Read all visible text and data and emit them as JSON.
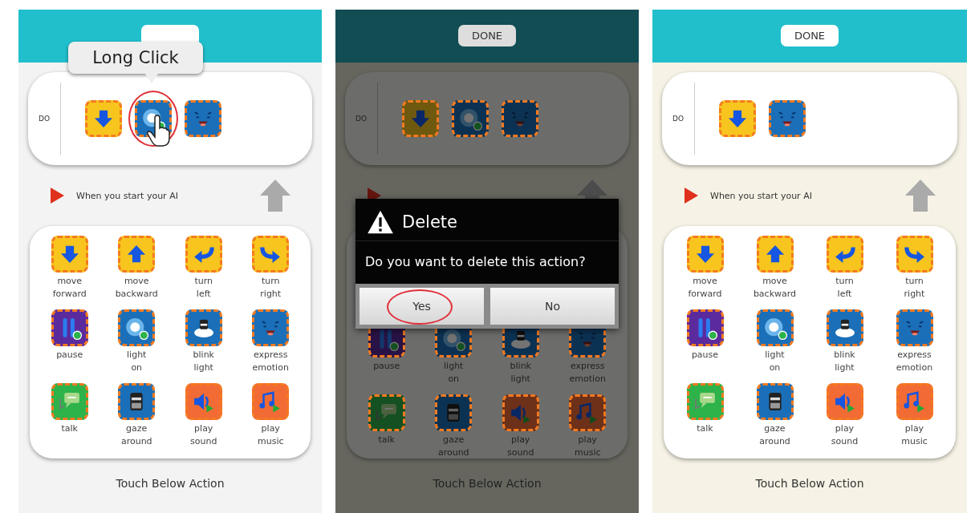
{
  "screens": [
    {
      "kind": "light",
      "tooltip": {
        "text": "Long Click"
      },
      "do_label": "DO",
      "do_items": [
        {
          "kind": "down",
          "color": "#f7c51e",
          "highlighted": false
        },
        {
          "kind": "light",
          "color": "#1a6fb8",
          "highlighted": true
        },
        {
          "kind": "emotion",
          "color": "#1a6fb8",
          "highlighted": false
        }
      ],
      "start_label": "When you start your AI",
      "palette": [
        {
          "kind": "down",
          "color": "#f7c51e",
          "label": "move\nforward"
        },
        {
          "kind": "up",
          "color": "#f7c51e",
          "label": "move\nbackward"
        },
        {
          "kind": "left",
          "color": "#f7c51e",
          "label": "turn\nleft"
        },
        {
          "kind": "right",
          "color": "#f7c51e",
          "label": "turn\nright"
        },
        {
          "kind": "pause",
          "color": "#5b2a9c",
          "label": "pause"
        },
        {
          "kind": "light",
          "color": "#1a6fb8",
          "label": "light\non"
        },
        {
          "kind": "blink",
          "color": "#1a6fb8",
          "label": "blink\nlight"
        },
        {
          "kind": "emotion",
          "color": "#1a6fb8",
          "label": "express\nemotion"
        },
        {
          "kind": "talk",
          "color": "#2db34a",
          "label": "talk"
        },
        {
          "kind": "gaze",
          "color": "#1a6fb8",
          "label": "gaze\naround"
        },
        {
          "kind": "sound",
          "color": "#f26b35",
          "label": "play\nsound"
        },
        {
          "kind": "music",
          "color": "#f26b35",
          "label": "play\nmusic"
        }
      ],
      "footer": "Touch Below Action"
    },
    {
      "kind": "dimmed",
      "done_label": "DONE",
      "do_label": "DO",
      "do_items": [
        {
          "kind": "down",
          "color": "#6f590e",
          "highlighted": false
        },
        {
          "kind": "light",
          "color": "#0c3253",
          "highlighted": false
        },
        {
          "kind": "emotion",
          "color": "#0c3253",
          "highlighted": false
        }
      ],
      "palette": [
        {
          "kind": "pause",
          "color": "#291346",
          "label": "pause"
        },
        {
          "kind": "light",
          "color": "#0c3253",
          "label": "light\non"
        },
        {
          "kind": "blink",
          "color": "#0c3253",
          "label": "blink\nlight"
        },
        {
          "kind": "emotion",
          "color": "#0c3253",
          "label": "express\nemotion"
        },
        {
          "kind": "talk",
          "color": "#145021",
          "label": "talk"
        },
        {
          "kind": "gaze",
          "color": "#0c3253",
          "label": "gaze\naround"
        },
        {
          "kind": "sound",
          "color": "#6d3018",
          "label": "play\nsound"
        },
        {
          "kind": "music",
          "color": "#6d3018",
          "label": "play\nmusic"
        }
      ],
      "footer": "Touch Below Action",
      "dialog": {
        "title": "Delete",
        "message": "Do you want to delete this action?",
        "buttons": [
          {
            "label": "Yes",
            "highlighted": true
          },
          {
            "label": "No",
            "highlighted": false
          }
        ]
      }
    },
    {
      "kind": "cream",
      "done_label": "DONE",
      "do_label": "DO",
      "do_items": [
        {
          "kind": "down",
          "color": "#f7c51e",
          "highlighted": false
        },
        {
          "kind": "emotion",
          "color": "#1a6fb8",
          "highlighted": false
        }
      ],
      "start_label": "When you start your AI",
      "palette": [
        {
          "kind": "down",
          "color": "#f7c51e",
          "label": "move\nforward"
        },
        {
          "kind": "up",
          "color": "#f7c51e",
          "label": "move\nbackward"
        },
        {
          "kind": "left",
          "color": "#f7c51e",
          "label": "turn\nleft"
        },
        {
          "kind": "right",
          "color": "#f7c51e",
          "label": "turn\nright"
        },
        {
          "kind": "pause",
          "color": "#5b2a9c",
          "label": "pause"
        },
        {
          "kind": "light",
          "color": "#1a6fb8",
          "label": "light\non"
        },
        {
          "kind": "blink",
          "color": "#1a6fb8",
          "label": "blink\nlight"
        },
        {
          "kind": "emotion",
          "color": "#1a6fb8",
          "label": "express\nemotion"
        },
        {
          "kind": "talk",
          "color": "#2db34a",
          "label": "talk"
        },
        {
          "kind": "gaze",
          "color": "#1a6fb8",
          "label": "gaze\naround"
        },
        {
          "kind": "sound",
          "color": "#f26b35",
          "label": "play\nsound"
        },
        {
          "kind": "music",
          "color": "#f26b35",
          "label": "play\nmusic"
        }
      ],
      "footer": "Touch Below Action"
    }
  ]
}
